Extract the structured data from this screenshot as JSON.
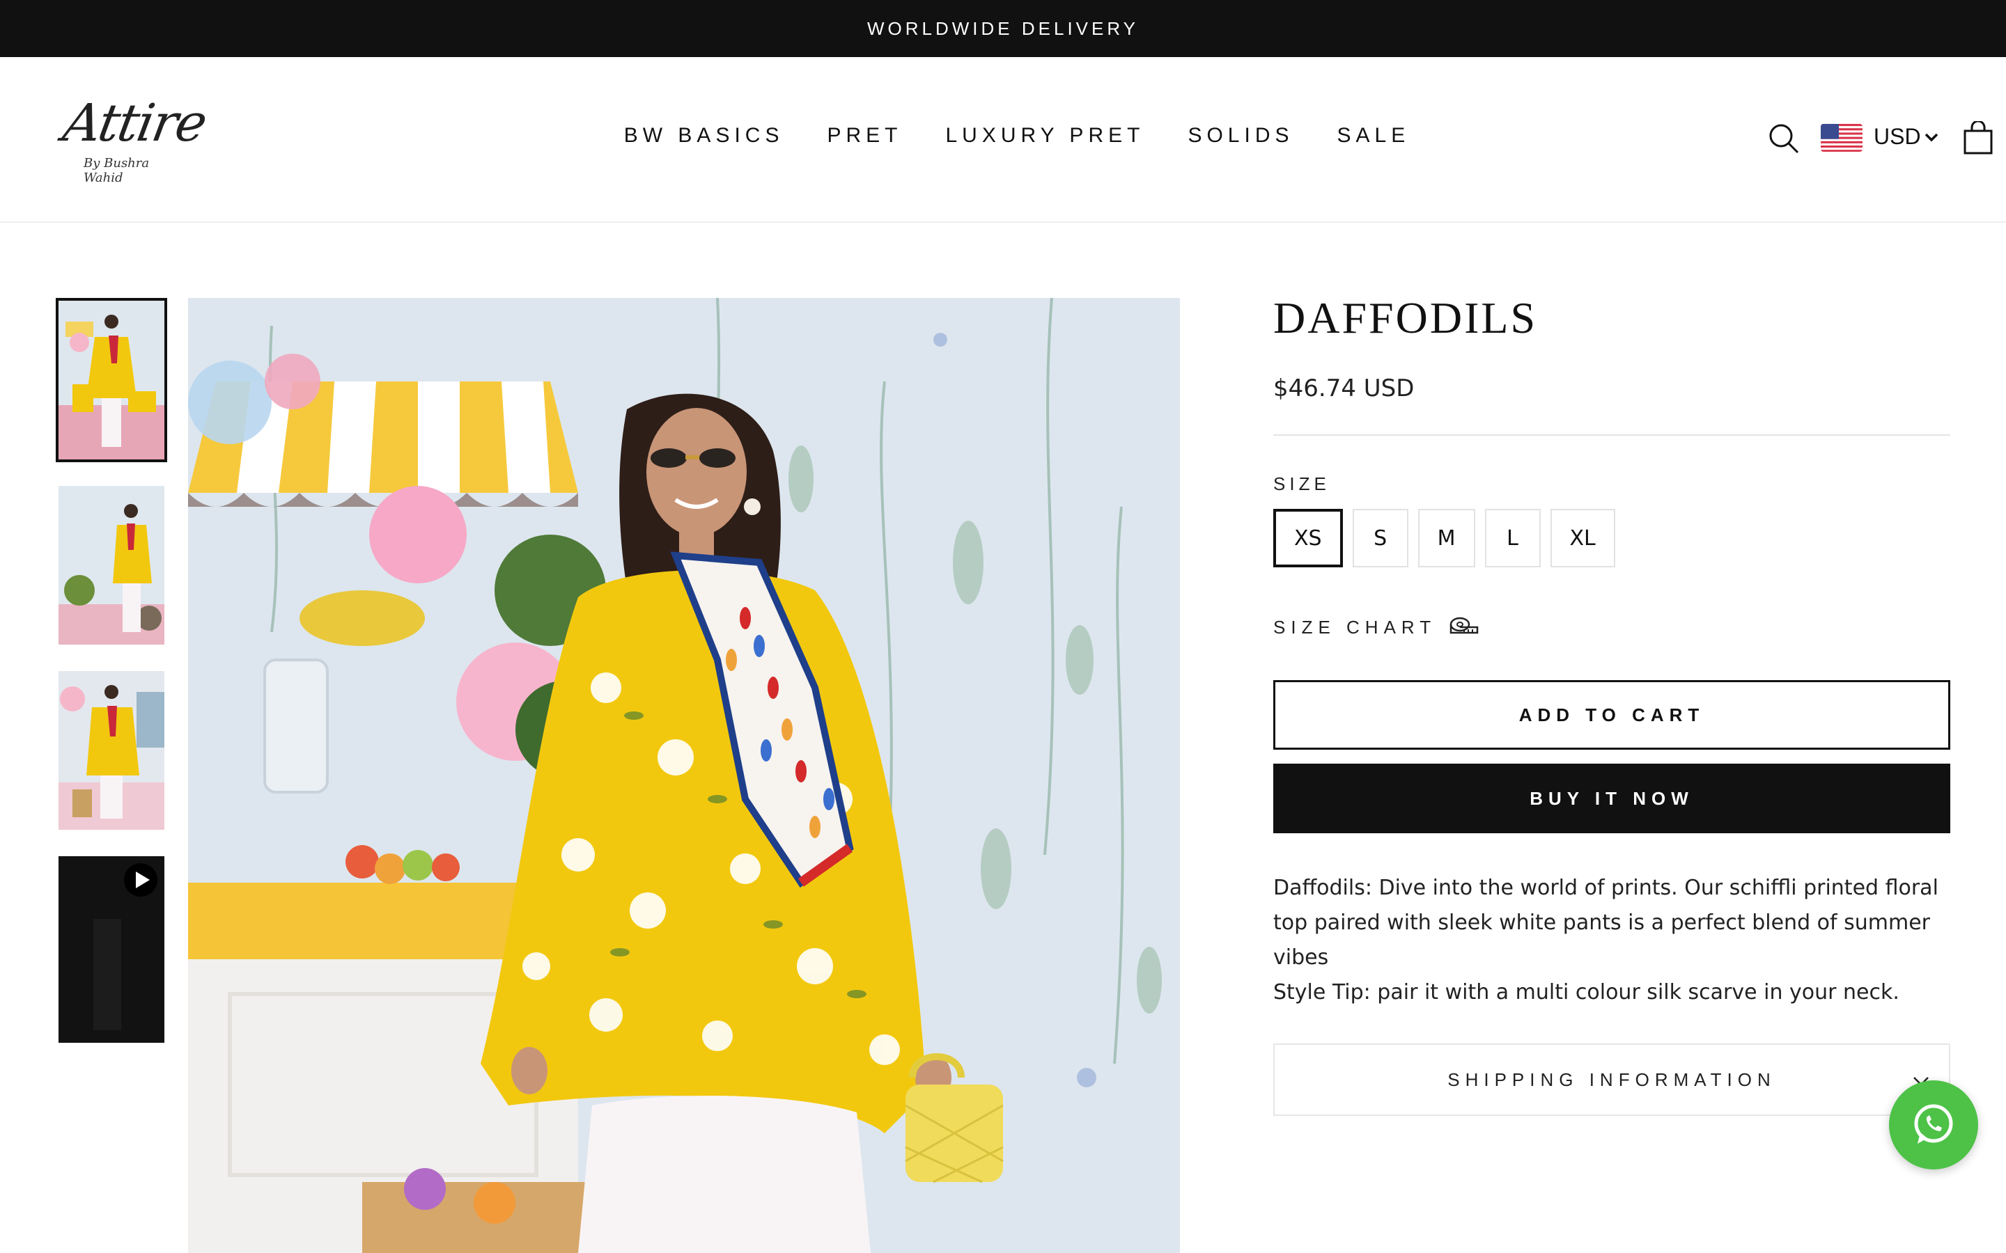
{
  "announcement": {
    "text": "WORLDWIDE DELIVERY"
  },
  "brand": {
    "logo_text": "Attire",
    "logo_subtext": "By Bushra Wahid"
  },
  "nav": {
    "items": [
      {
        "label": "BW BASICS"
      },
      {
        "label": "PRET"
      },
      {
        "label": "LUXURY PRET"
      },
      {
        "label": "SOLIDS"
      },
      {
        "label": "SALE"
      }
    ]
  },
  "header": {
    "search_icon": "search-icon",
    "currency": {
      "flag": "us-flag",
      "code": "USD"
    },
    "cart_icon": "cart-icon"
  },
  "gallery": {
    "thumbnails": [
      {
        "type": "image",
        "selected": true
      },
      {
        "type": "image",
        "selected": false
      },
      {
        "type": "image",
        "selected": false
      },
      {
        "type": "video",
        "selected": false
      }
    ]
  },
  "product": {
    "title": "DAFFODILS",
    "price": "$46.74 USD",
    "size_label": "SIZE",
    "sizes": [
      "XS",
      "S",
      "M",
      "L",
      "XL"
    ],
    "selected_size": "XS",
    "size_chart_label": "SIZE CHART",
    "add_to_cart_label": "ADD TO CART",
    "buy_now_label": "BUY IT NOW",
    "description": [
      "Daffodils: Dive into the world of prints. Our schiffli printed floral",
      "top paired with sleek white pants is a perfect blend of summer vibes",
      "Style Tip: pair it with a multi colour silk scarve in your neck."
    ],
    "shipping_label": "SHIPPING INFORMATION"
  },
  "colors": {
    "announcement_bg": "#111111",
    "primary_button_bg": "#111111",
    "whatsapp": "#4dc247",
    "dress_yellow": "#f2c80f"
  }
}
